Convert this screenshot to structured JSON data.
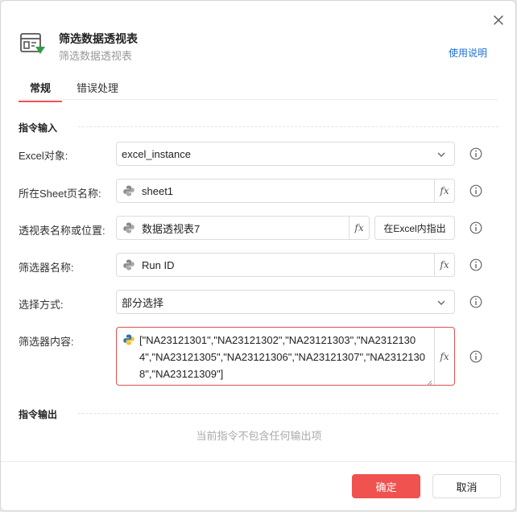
{
  "header": {
    "title": "筛选数据透视表",
    "subtitle": "筛选数据透视表",
    "help_link": "使用说明",
    "app_icon": "pivot-filter-icon",
    "close_icon": "close-icon"
  },
  "tabs": [
    {
      "label": "常规",
      "active": true
    },
    {
      "label": "错误处理",
      "active": false
    }
  ],
  "sections": {
    "input": "指令输入",
    "output": "指令输出"
  },
  "fields": {
    "excel_object": {
      "label": "Excel对象:",
      "value": "excel_instance"
    },
    "sheet_name": {
      "label": "所在Sheet页名称:",
      "value": "sheet1"
    },
    "pivot_name": {
      "label": "透视表名称或位置:",
      "value": "数据透视表7",
      "locate_button": "在Excel内指出"
    },
    "filter_name": {
      "label": "筛选器名称:",
      "value": "Run ID"
    },
    "select_mode": {
      "label": "选择方式:",
      "value": "部分选择"
    },
    "filter_content": {
      "label": "筛选器内容:",
      "value": "[\"NA23121301\",\"NA23121302\",\"NA23121303\",\"NA23121304\",\"NA23121305\",\"NA23121306\",\"NA23121307\",\"NA23121308\",\"NA23121309\"]"
    }
  },
  "fx_label": "fx",
  "output_empty": "当前指令不包含任何输出项",
  "footer": {
    "confirm": "确定",
    "cancel": "取消"
  },
  "colors": {
    "accent": "#f0524f",
    "link": "#1e6fd9",
    "error_border": "#e05050"
  }
}
